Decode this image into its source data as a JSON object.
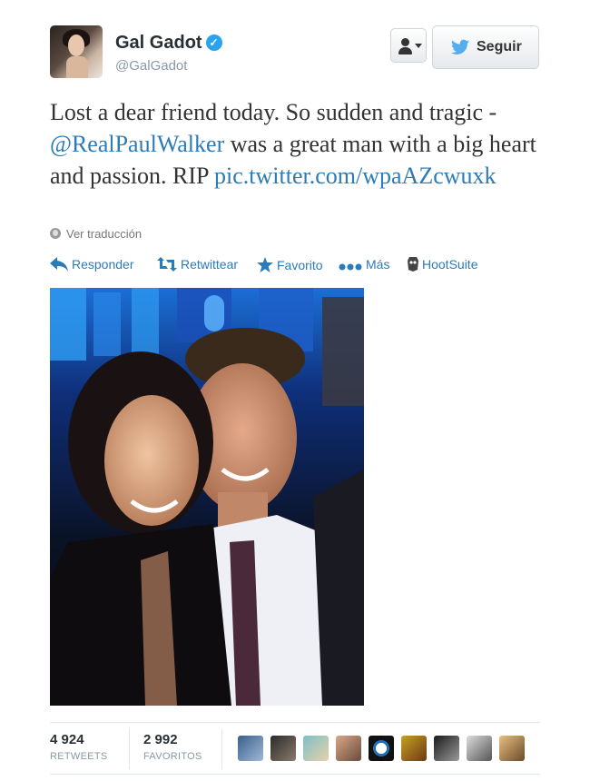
{
  "user": {
    "name": "Gal Gadot",
    "handle": "@GalGadot",
    "verified": true
  },
  "header": {
    "follow_label": "Seguir"
  },
  "tweet": {
    "text_before": "Lost a dear friend today. So sudden and tragic - ",
    "mention": "@RealPaulWalker",
    "text_after": " was a great man with a big heart and passion. RIP ",
    "pic_link": "pic.twitter.com/wpaAZcwuxk"
  },
  "translate_label": "Ver traducción",
  "actions": {
    "reply": "Responder",
    "retweet": "Retwittear",
    "favorite": "Favorito",
    "more": "Más",
    "hootsuite": "HootSuite"
  },
  "stats": {
    "retweets_count": "4 924",
    "retweets_label": "RETWEETS",
    "favorites_count": "2 992",
    "favorites_label": "FAVORITOS"
  },
  "colors": {
    "link": "#2b7bb9",
    "verified": "#2aa3ef",
    "twitter_bird": "#55acee"
  }
}
